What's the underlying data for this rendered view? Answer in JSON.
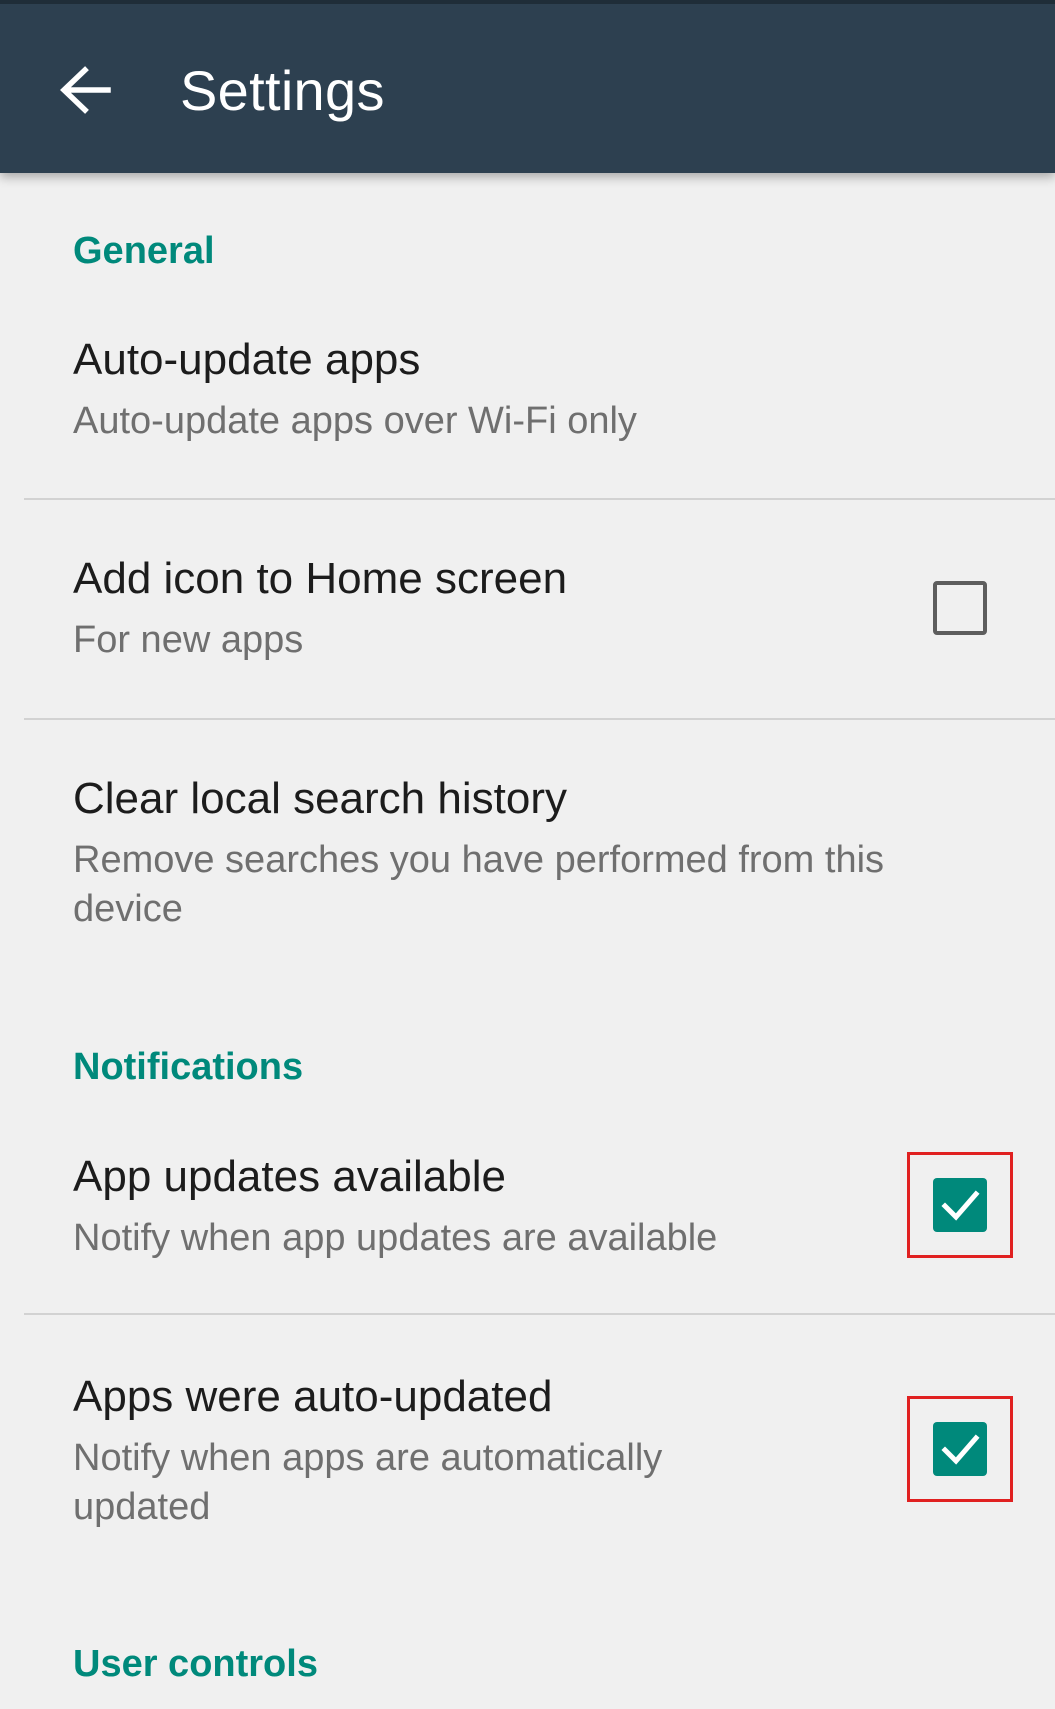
{
  "app_bar": {
    "title": "Settings",
    "back_icon": "arrow-back-icon"
  },
  "sections": {
    "general": {
      "header": "General",
      "items": [
        {
          "title": "Auto-update apps",
          "subtitle": "Auto-update apps over Wi-Fi only"
        },
        {
          "title": "Add icon to Home screen",
          "subtitle": "For new apps",
          "checkbox": "unchecked"
        },
        {
          "title": "Clear local search history",
          "subtitle": "Remove searches you have performed from this device"
        }
      ]
    },
    "notifications": {
      "header": "Notifications",
      "items": [
        {
          "title": "App updates available",
          "subtitle": "Notify when app updates are available",
          "checkbox": "checked"
        },
        {
          "title": "Apps were auto-updated",
          "subtitle": "Notify when apps are automatically updated",
          "checkbox": "checked"
        }
      ]
    },
    "user_controls": {
      "header": "User controls"
    }
  },
  "colors": {
    "app_bar_bg": "#2d4050",
    "accent": "#00897b",
    "background": "#f0f0f0",
    "highlight": "#e02020"
  }
}
